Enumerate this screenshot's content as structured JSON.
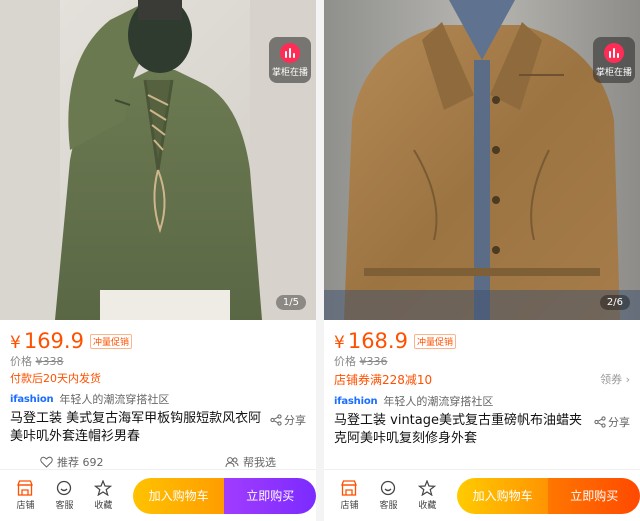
{
  "colors": {
    "price": "#ff5000",
    "cart_button": "#ffb000",
    "buy_button_left": "#8e33ff",
    "buy_button_right": "#ff5a00",
    "live": "#ff2d55"
  },
  "left": {
    "live_label": "掌柜在播",
    "page_indicator": "1/5",
    "price_symbol": "¥",
    "price": "169.9",
    "promo_tag": "冲量促销",
    "orig_label": "价格",
    "orig_price": "¥338",
    "shipping_note": "付款后20天内发货",
    "community_logo": "ifashion",
    "community_text": "年轻人的潮流穿搭社区",
    "title": "马登工装 美式复古海军甲板钩服短款风衣阿美咔叽外套连帽衫男春",
    "share_label": "分享",
    "recommend_label": "推荐 692",
    "help_pick_label": "帮我选",
    "tabs": [
      {
        "label": "店铺",
        "icon": "store-icon"
      },
      {
        "label": "客服",
        "icon": "service-icon"
      },
      {
        "label": "收藏",
        "icon": "star-icon"
      }
    ],
    "cart_label": "加入购物车",
    "buy_label": "立即购买"
  },
  "right": {
    "live_label": "掌柜在播",
    "page_indicator": "2/6",
    "price_symbol": "¥",
    "price": "168.9",
    "promo_tag": "冲量促销",
    "orig_label": "价格",
    "orig_price": "¥336",
    "coupon_text": "店铺券满228减10",
    "coupon_link": "领券 ›",
    "community_logo": "ifashion",
    "community_text": "年轻人的潮流穿搭社区",
    "title": "马登工装 vintage美式复古重磅帆布油蜡夹克阿美咔叽复刻修身外套",
    "share_label": "分享",
    "tabs": [
      {
        "label": "店铺",
        "icon": "store-icon"
      },
      {
        "label": "客服",
        "icon": "service-icon"
      },
      {
        "label": "收藏",
        "icon": "star-icon"
      }
    ],
    "cart_label": "加入购物车",
    "buy_label": "立即购买"
  }
}
